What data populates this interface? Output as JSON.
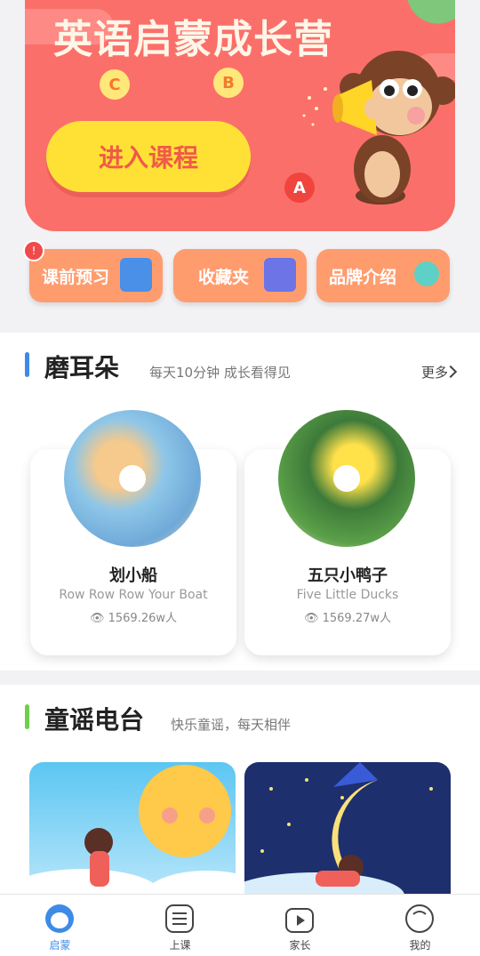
{
  "banner": {
    "title": "英语启蒙成长营",
    "enter_label": "进入课程",
    "letters": [
      "C",
      "B",
      "A"
    ]
  },
  "quick": [
    {
      "label": "课前预习",
      "icon": "gift-book-icon",
      "badge": "!"
    },
    {
      "label": "收藏夹",
      "icon": "thumbs-up-notebook-icon"
    },
    {
      "label": "品牌介绍",
      "icon": "microphone-icon"
    }
  ],
  "ears": {
    "title": "磨耳朵",
    "subtitle": "每天10分钟 成长看得见",
    "more": "更多",
    "cards": [
      {
        "title": "划小船",
        "subtitle": "Row Row Row Your Boat",
        "views": "1569.26w人"
      },
      {
        "title": "五只小鸭子",
        "subtitle": "Five Little Ducks",
        "views": "1569.27w人"
      }
    ]
  },
  "radio": {
    "title": "童谣电台",
    "subtitle": "快乐童谣，每天相伴"
  },
  "tabs": [
    {
      "label": "启蒙",
      "icon": "monkey-head-icon",
      "active": true
    },
    {
      "label": "上课",
      "icon": "list-icon"
    },
    {
      "label": "家长",
      "icon": "video-play-icon"
    },
    {
      "label": "我的",
      "icon": "profile-circle-icon"
    }
  ],
  "colors": {
    "banner": "#fb6f6a",
    "accent_blue": "#3d8be6",
    "accent_green": "#6fce4a",
    "quick_bg": "#ff9c6e"
  }
}
